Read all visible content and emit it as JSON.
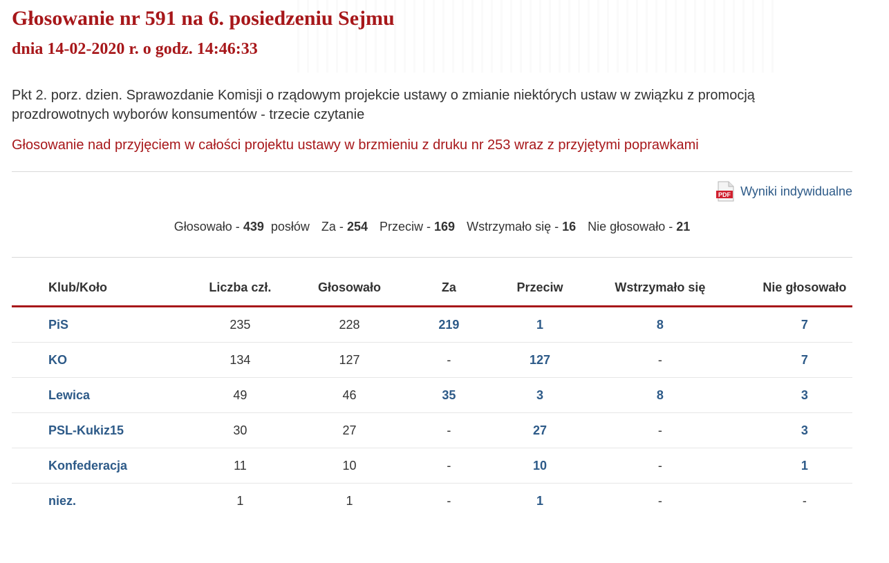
{
  "header": {
    "title": "Głosowanie nr 591 na 6. posiedzeniu Sejmu",
    "subtitle": "dnia 14-02-2020 r. o godz. 14:46:33"
  },
  "topic": "Pkt 2. porz. dzien. Sprawozdanie Komisji o rządowym projekcie ustawy o zmianie niektórych ustaw w związku z promocją prozdrowotnych wyborów konsumentów - trzecie czytanie",
  "voting_description": "Głosowanie nad przyjęciem w całości projektu ustawy w brzmieniu z druku nr 253 wraz z przyjętymi poprawkami",
  "pdf": {
    "icon_text": "PDF",
    "label": "Wyniki indywidualne",
    "icon_color": "#d0202e"
  },
  "summary": {
    "voted_label": "Głosowało - ",
    "voted": "439",
    "voted_suffix": "posłów",
    "za_label": "Za - ",
    "za": "254",
    "przeciw_label": "Przeciw - ",
    "przeciw": "169",
    "wstrzymalo_label": "Wstrzymało się - ",
    "wstrzymalo": "16",
    "nie_glosowalo_label": "Nie głosowało - ",
    "nie_glosowalo": "21"
  },
  "table": {
    "headers": [
      "Klub/Koło",
      "Liczba czł.",
      "Głosowało",
      "Za",
      "Przeciw",
      "Wstrzymało się",
      "Nie głosowało"
    ],
    "rows": [
      {
        "club": "PiS",
        "members": "235",
        "voted": "228",
        "za": "219",
        "przeciw": "1",
        "wstrzymalo": "8",
        "nie": "7"
      },
      {
        "club": "KO",
        "members": "134",
        "voted": "127",
        "za": "-",
        "przeciw": "127",
        "wstrzymalo": "-",
        "nie": "7"
      },
      {
        "club": "Lewica",
        "members": "49",
        "voted": "46",
        "za": "35",
        "przeciw": "3",
        "wstrzymalo": "8",
        "nie": "3"
      },
      {
        "club": "PSL-Kukiz15",
        "members": "30",
        "voted": "27",
        "za": "-",
        "przeciw": "27",
        "wstrzymalo": "-",
        "nie": "3"
      },
      {
        "club": "Konfederacja",
        "members": "11",
        "voted": "10",
        "za": "-",
        "przeciw": "10",
        "wstrzymalo": "-",
        "nie": "1"
      },
      {
        "club": "niez.",
        "members": "1",
        "voted": "1",
        "za": "-",
        "przeciw": "1",
        "wstrzymalo": "-",
        "nie": "-"
      }
    ]
  },
  "colors": {
    "accent_red": "#a7171a",
    "link_blue": "#2d5a88",
    "text": "#333333"
  }
}
